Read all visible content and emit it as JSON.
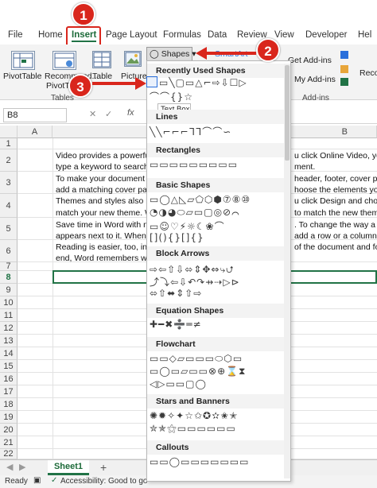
{
  "ribbon_tabs": [
    "File",
    "Home",
    "Insert",
    "Page Layout",
    "Formulas",
    "Data",
    "Review",
    "View",
    "Developer",
    "Hel"
  ],
  "ribbon": {
    "pivottable": "PivotTable",
    "recommended": "Recommend...",
    "recommended2": "PivotTa...",
    "table": "Table",
    "pictures": "Pictures",
    "tables_group": "Tables",
    "smartart": "SmartArt",
    "get_addins": "Get Add-ins",
    "my_addins": "My Add-ins",
    "addins_group": "Add-ins",
    "reco": "Reco"
  },
  "formula_bar": {
    "namebox": "B8",
    "fx": "fx"
  },
  "columns": [
    "A",
    "B"
  ],
  "rows": [
    "1",
    "2",
    "3",
    "4",
    "5",
    "6",
    "7",
    "8",
    "9",
    "10",
    "11",
    "12",
    "13",
    "14",
    "15",
    "16",
    "17",
    "18",
    "19",
    "20",
    "21",
    "22",
    "23"
  ],
  "cells": {
    "r2a": "Video provides a powerful w",
    "r2b": "type a keyword to search o",
    "r3a": "To make your document loc",
    "r3b": "add a matching cover page",
    "r4a": "Themes and styles also help",
    "r4b": "match your new theme. Wh",
    "r5a": "Save time in Word with new",
    "r5b": "appears next to it. When yo",
    "r6a": "Reading is easier, too, in the",
    "r6b": "end, Word remembers whe",
    "r2c": "u click Online Video, you",
    "r2d": "ment.",
    "r3c": "header, footer, cover pa",
    "r3d": "hoose the elements you",
    "r4c": "u click Design and choc",
    "r4d": "to match the new theme",
    "r5c": ". To change the way a",
    "r5d": "add a row or a column,",
    "r6c": "of the document and fo"
  },
  "shapes_menu": {
    "button_label": "Shapes",
    "tooltip": "Text Box",
    "sections": [
      "Recently Used Shapes",
      "Lines",
      "Rectangles",
      "Basic Shapes",
      "Block Arrows",
      "Equation Shapes",
      "Flowchart",
      "Stars and Banners",
      "Callouts"
    ],
    "recent_row1": "▭╲▢▭△⌐⇨⇩☐▷",
    "recent_row2": "⌒⌒{}☆",
    "lines_row": "╲╲⌐⌐⌐ᒣᒣ⌒⌒∽",
    "rect_row": "▭▭▭▭▭▭▭▭▭",
    "basic_rows": [
      "▭◯△◺▱⬠⬡⬢⑦⑧⑩",
      "◔◑◕⬭▱▭▢◎⊘⌒",
      "▭☺♡⚡☼☾❀⌒",
      "[](){}[]{}"
    ],
    "arrow_rows": [
      "⇨⇦⇧⇩⬄⇕✥⇔⤷⮍",
      "⤴⤵⇦⇩↶↷⇸⇢▷⊳",
      "⬄⇧⬌⇕⇧⇨"
    ],
    "equation_row": "✚━✖➗═≠",
    "flow_rows": [
      "▭▭◇▱▭▭▭⬭⬡▭",
      "▭◯▭▱▭▭⊗⊕⌛⧗",
      "◁▷▭▭▢◯"
    ],
    "star_rows": [
      "✺✹✧✦☆✩✪✫✬✭",
      "✮✯⚝▭▭▭▭▭▭"
    ],
    "callout_row": "▭▭◯▭▭▭▭▭▭▭"
  },
  "steps": [
    "1",
    "2",
    "3"
  ],
  "sheet_tab": "Sheet1",
  "add_sheet": "+",
  "status": {
    "ready": "Ready",
    "accessibility": "Accessibility: Good to go"
  },
  "colors": {
    "accent": "#217346",
    "callout": "#d9261c"
  }
}
